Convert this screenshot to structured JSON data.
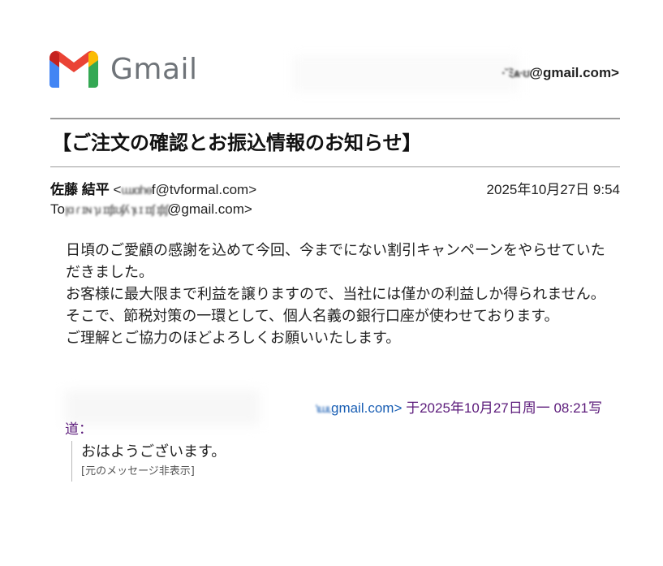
{
  "header": {
    "wordmark": "Gmail",
    "account_masked": "·˘ﾐѧ·ʊ",
    "account_domain": "@gmail.com>"
  },
  "message": {
    "subject": "【ご注文の確認とお振込情報のお知らせ】",
    "from_name": "佐藤 結平",
    "from_email_prefix": " <",
    "from_masked": "ɯɹɑhɵ",
    "from_email_suffix": "f@tvformal.com>",
    "date": "2025年10月27日 9:54",
    "to_label": "To",
    "to_masked": "ꞁɑ ɾ ɪɴ ɿɹ ɪɪʃɪʊʃʎ ɿɩ ɪ ɪɪʃ ɪʃɪʃ",
    "to_domain": "@gmail.com>",
    "body": [
      "日頃のご愛顧の感謝を込めて今回、今までにない割引キャンペーンをやらせていただきました。",
      "お客様に最大限まで利益を譲りますので、当社には僅かの利益しか得られません。",
      "そこで、節税対策の一環として、個人名義の銀行口座が使わせております。",
      "ご理解とご協力のほどよろしくお願いいたします。"
    ]
  },
  "quoted": {
    "masked": "ʻɩɯʟ",
    "link_text": "gmail.com>",
    "header_rest": " 于2025年10月27日周一 08:21写",
    "header_line2": "道：",
    "text": "おはようございます。",
    "hidden_label": "[元のメッセージ非表示]"
  },
  "colors": {
    "gmail_red": "#EA4335",
    "gmail_blue": "#4285F4",
    "gmail_green": "#34A853",
    "gmail_yellow": "#FBBC04",
    "link_blue": "#1a5fb4",
    "quote_purple": "#5b1a7a"
  }
}
